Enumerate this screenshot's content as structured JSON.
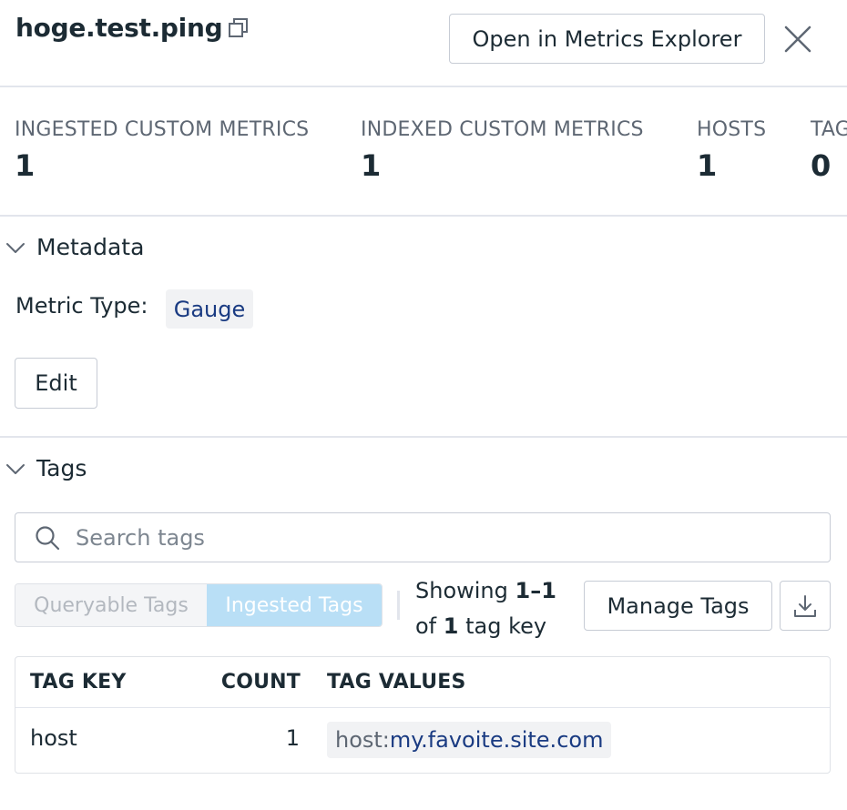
{
  "header": {
    "title": "hoge.test.ping",
    "open_explorer_label": "Open in Metrics Explorer"
  },
  "stats": [
    {
      "label": "INGESTED CUSTOM METRICS",
      "value": "1"
    },
    {
      "label": "INDEXED CUSTOM METRICS",
      "value": "1"
    },
    {
      "label": "HOSTS",
      "value": "1"
    },
    {
      "label": "TAGS",
      "value": "0"
    }
  ],
  "metadata": {
    "section_title": "Metadata",
    "metric_type_label": "Metric Type:",
    "metric_type_value": "Gauge",
    "edit_label": "Edit"
  },
  "tags": {
    "section_title": "Tags",
    "search_placeholder": "Search tags",
    "toggle": {
      "queryable_label": "Queryable Tags",
      "ingested_label": "Ingested Tags",
      "active": "ingested"
    },
    "showing": {
      "prefix": "Showing",
      "range": "1–1",
      "of_word": "of",
      "total": "1",
      "suffix": "tag key"
    },
    "manage_label": "Manage Tags",
    "table": {
      "columns": [
        "TAG KEY",
        "COUNT",
        "TAG VALUES"
      ],
      "rows": [
        {
          "key": "host",
          "count": "1",
          "value_key": "host:",
          "value_val": "my.favoite.site.com"
        }
      ]
    }
  },
  "icons": {
    "copy": "copy-icon",
    "close": "close-icon",
    "chevron": "chevron-down-icon",
    "search": "search-icon",
    "download": "download-icon"
  },
  "colors": {
    "text": "#1c2b34",
    "muted": "#5e6773",
    "link": "#1a3b82",
    "toggle_active_bg": "#b9dff6",
    "border": "#c7ccd5"
  }
}
